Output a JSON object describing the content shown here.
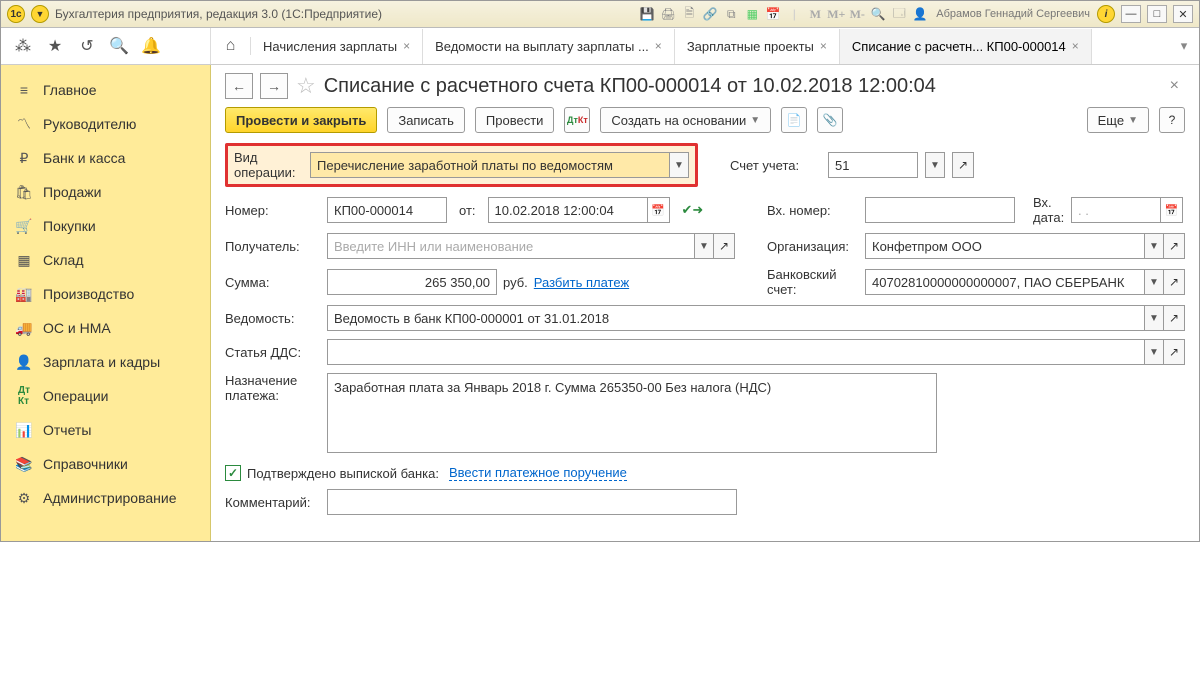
{
  "titlebar": {
    "app": "Бухгалтерия предприятия, редакция 3.0  (1С:Предприятие)",
    "user": "Абрамов Геннадий Сергеевич",
    "m1": "M",
    "m2": "M+",
    "m3": "M-"
  },
  "tabs": {
    "t1": "Начисления зарплаты",
    "t2": "Ведомости на выплату зарплаты ...",
    "t3": "Зарплатные проекты",
    "t4": "Списание с расчетн... КП00-000014"
  },
  "nav": {
    "n1": "Главное",
    "n2": "Руководителю",
    "n3": "Банк и касса",
    "n4": "Продажи",
    "n5": "Покупки",
    "n6": "Склад",
    "n7": "Производство",
    "n8": "ОС и НМА",
    "n9": "Зарплата и кадры",
    "n10": "Операции",
    "n11": "Отчеты",
    "n12": "Справочники",
    "n13": "Администрирование"
  },
  "doc": {
    "title": "Списание с расчетного счета КП00-000014 от 10.02.2018 12:00:04",
    "btn_post_close": "Провести и закрыть",
    "btn_save": "Записать",
    "btn_post": "Провести",
    "btn_based": "Создать на основании",
    "btn_more": "Еще",
    "btn_help": "?"
  },
  "f": {
    "op_label": "Вид операции:",
    "op_value": "Перечисление заработной платы по ведомостям",
    "acc_label": "Счет учета:",
    "acc_value": "51",
    "num_label": "Номер:",
    "num_value": "КП00-000014",
    "from_label": "от:",
    "date_value": "10.02.2018 12:00:04",
    "inum_label": "Вх. номер:",
    "idate_label": "Вх. дата:",
    "idate_ph": ".   .",
    "recip_label": "Получатель:",
    "recip_ph": "Введите ИНН или наименование",
    "org_label": "Организация:",
    "org_value": "Конфетпром ООО",
    "sum_label": "Сумма:",
    "sum_value": "265 350,00",
    "rub": "руб.",
    "split_link": "Разбить платеж",
    "bank_label": "Банковский счет:",
    "bank_value": "40702810000000000007, ПАО СБЕРБАНК",
    "ved_label": "Ведомость:",
    "ved_value": "Ведомость в банк КП00-000001 от 31.01.2018",
    "dds_label": "Статья ДДС:",
    "purpose_label": "Назначение платежа:",
    "purpose_value": "Заработная плата за Январь 2018 г. Сумма 265350-00 Без налога (НДС)",
    "confirmed_label": "Подтверждено выпиской банка:",
    "enter_po": "Ввести платежное поручение",
    "comment_label": "Комментарий:"
  }
}
